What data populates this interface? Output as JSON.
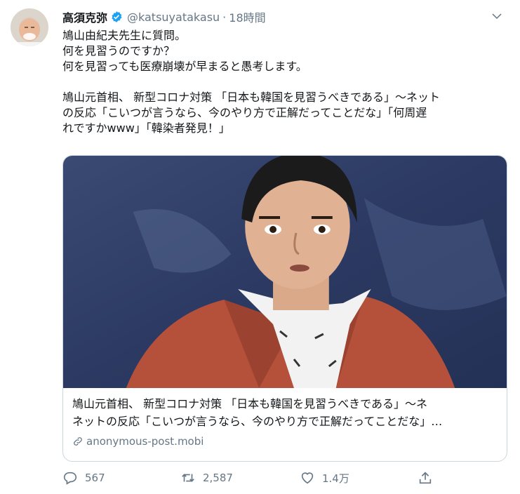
{
  "tweet": {
    "author_name": "高須克弥",
    "handle": "@katsuyatakasu",
    "separator": "·",
    "time": "18時間",
    "text": "鳩山由紀夫先生に質問。\n何を見習うのですか？\n何を見習っても医療崩壊が早まると愚考します。\n\n鳩山元首相、 新型コロナ対策 「日本も韓国を見習うべきである」～ネット\nの反応「こいつが言うなら、今のやり方で正解だってことだな」「何周遅\nれですかwww」「韓染者発見！」"
  },
  "card": {
    "title_line1": "鳩山元首相、 新型コロナ対策 「日本も韓国を見習うべきである」～ネ",
    "title_line2": "ネットの反応「こいつが言うなら、今のやり方で正解だってことだな」…",
    "domain": "anonymous-post.mobi"
  },
  "actions": {
    "reply_count": "567",
    "retweet_count": "2,587",
    "like_count": "1.4万"
  },
  "colors": {
    "text": "#14171a",
    "secondary": "#657786",
    "verified": "#1da1f2",
    "border": "#ccd6dd"
  },
  "icons": [
    "verified-badge-icon",
    "chevron-down-icon",
    "link-icon",
    "reply-icon",
    "retweet-icon",
    "like-icon",
    "share-icon"
  ]
}
